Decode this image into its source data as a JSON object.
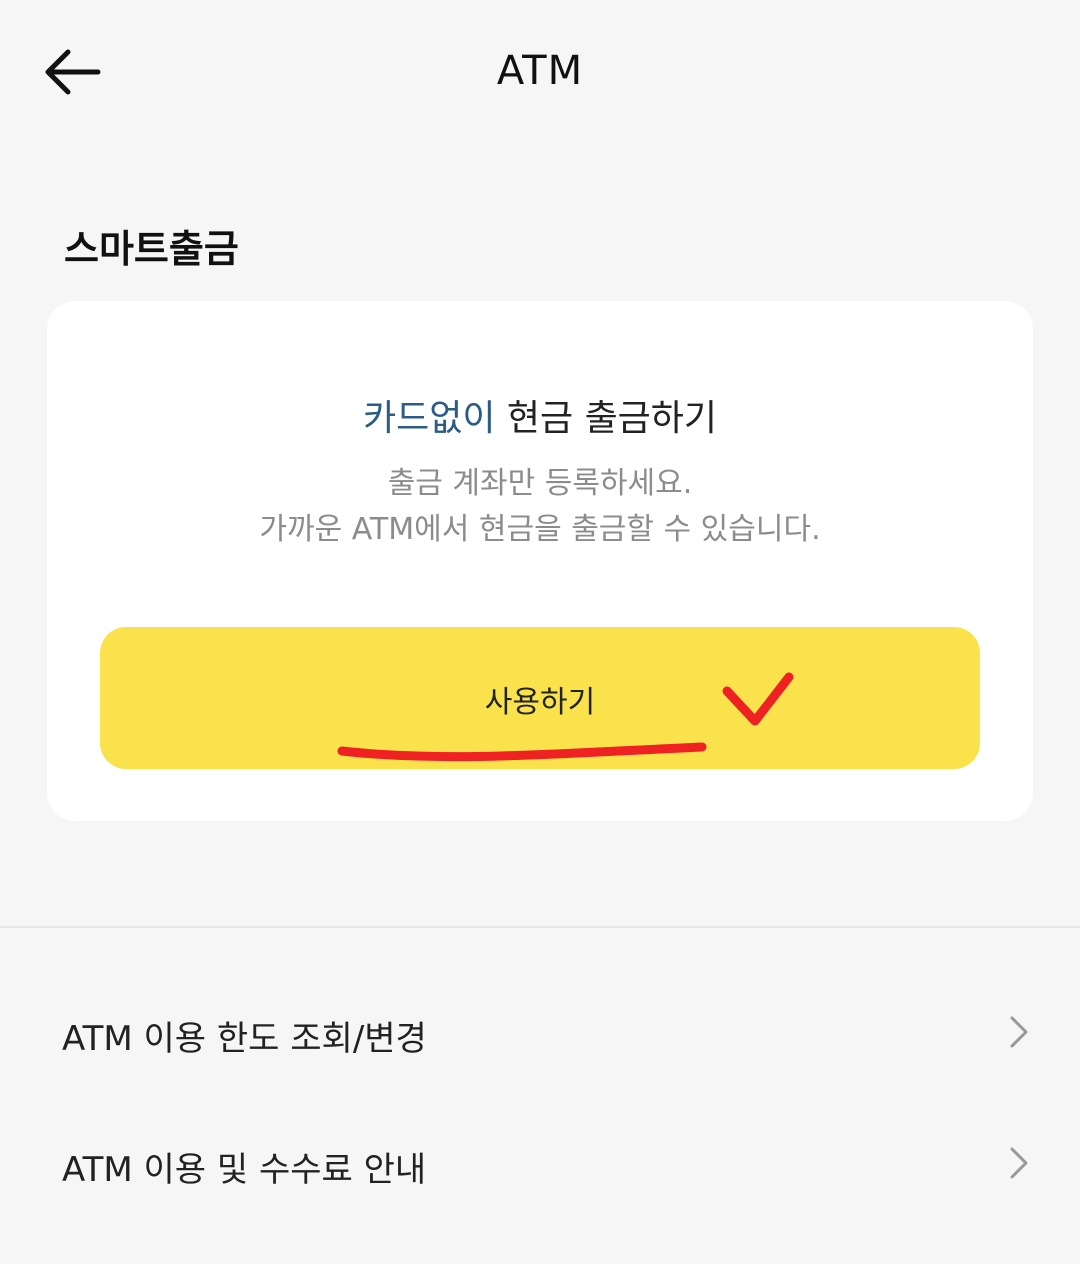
{
  "header": {
    "title": "ATM",
    "back_icon": "arrow-left-icon"
  },
  "smart_withdrawal": {
    "section_title": "스마트출금",
    "headline_highlight": "카드없이",
    "headline_rest": " 현금 출금하기",
    "description_line1": "출금 계좌만 등록하세요.",
    "description_line2": "가까운 ATM에서 현금을 출금할 수 있습니다.",
    "button_label": "사용하기",
    "button_color": "#f9e24b",
    "highlight_color": "#2b5c86",
    "annotation_color": "#ee2222"
  },
  "menu": [
    {
      "label": "ATM 이용 한도 조회/변경",
      "icon": "chevron-right-icon"
    },
    {
      "label": "ATM 이용 및 수수료 안내",
      "icon": "chevron-right-icon"
    }
  ]
}
